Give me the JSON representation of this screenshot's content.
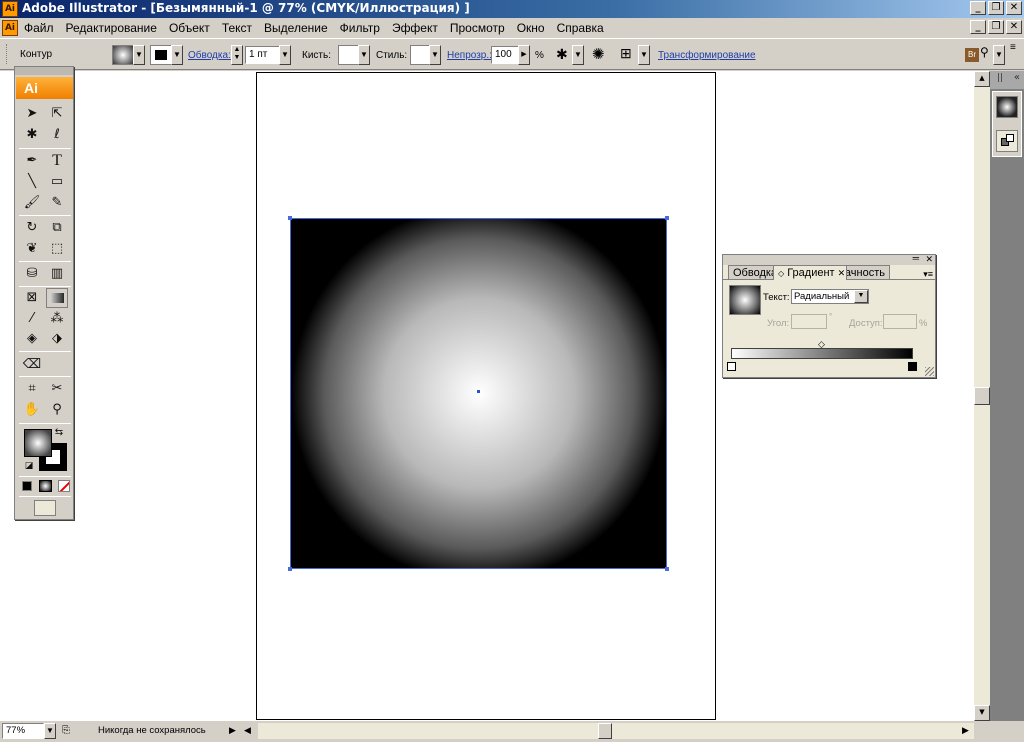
{
  "window": {
    "title": "Adobe Illustrator - [Безымянный-1 @ 77% (CMYK/Иллюстрация) ]",
    "app_icon_text": "Ai",
    "controls": {
      "minimize": "_",
      "restore": "❐",
      "close": "✕"
    }
  },
  "menubar": {
    "items": [
      "Файл",
      "Редактирование",
      "Объект",
      "Текст",
      "Выделение",
      "Фильтр",
      "Эффект",
      "Просмотр",
      "Окно",
      "Справка"
    ]
  },
  "controlbar": {
    "mode_label": "Контур",
    "stroke_link": "Обводка:",
    "stroke_weight": "1 пт",
    "brush_label": "Кисть:",
    "style_label": "Стиль:",
    "opacity_link": "Непрозр.:",
    "opacity_value": "100",
    "opacity_unit": "%",
    "transform_link": "Трансформирование",
    "bridge_label": "Br"
  },
  "tools": {
    "logo": "Ai",
    "icons": [
      "selection-tool",
      "direct-selection-tool",
      "magic-wand-tool",
      "lasso-tool",
      "pen-tool",
      "type-tool",
      "line-tool",
      "rectangle-tool",
      "paintbrush-tool",
      "pencil-tool",
      "rotate-tool",
      "scale-tool",
      "warp-tool",
      "free-transform-tool",
      "symbol-sprayer-tool",
      "column-graph-tool",
      "mesh-tool",
      "gradient-tool",
      "eyedropper-tool",
      "blend-tool",
      "live-paint-bucket-tool",
      "live-paint-selection-tool",
      "eraser-tool",
      "slice-tool",
      "scissors-tool",
      "hand-tool",
      "zoom-tool"
    ],
    "active_tool": "gradient-tool"
  },
  "gradient_panel": {
    "tabs": [
      "Обводка",
      "Градиент",
      "Прозрачность"
    ],
    "active_tab": "Градиент",
    "type_label": "Текст:",
    "type_value": "Радиальный",
    "angle_label": "Угол:",
    "location_label": "Доступ:",
    "location_unit": "%",
    "stops": [
      {
        "position": 0,
        "color": "#ffffff"
      },
      {
        "position": 100,
        "color": "#000000"
      }
    ]
  },
  "document": {
    "object": "radial-gradient-rectangle",
    "gradient_center": "#ffffff",
    "gradient_edge": "#000000",
    "selection_color": "#4b6ad9"
  },
  "statusbar": {
    "zoom": "77%",
    "status_text": "Никогда не сохранялось"
  }
}
